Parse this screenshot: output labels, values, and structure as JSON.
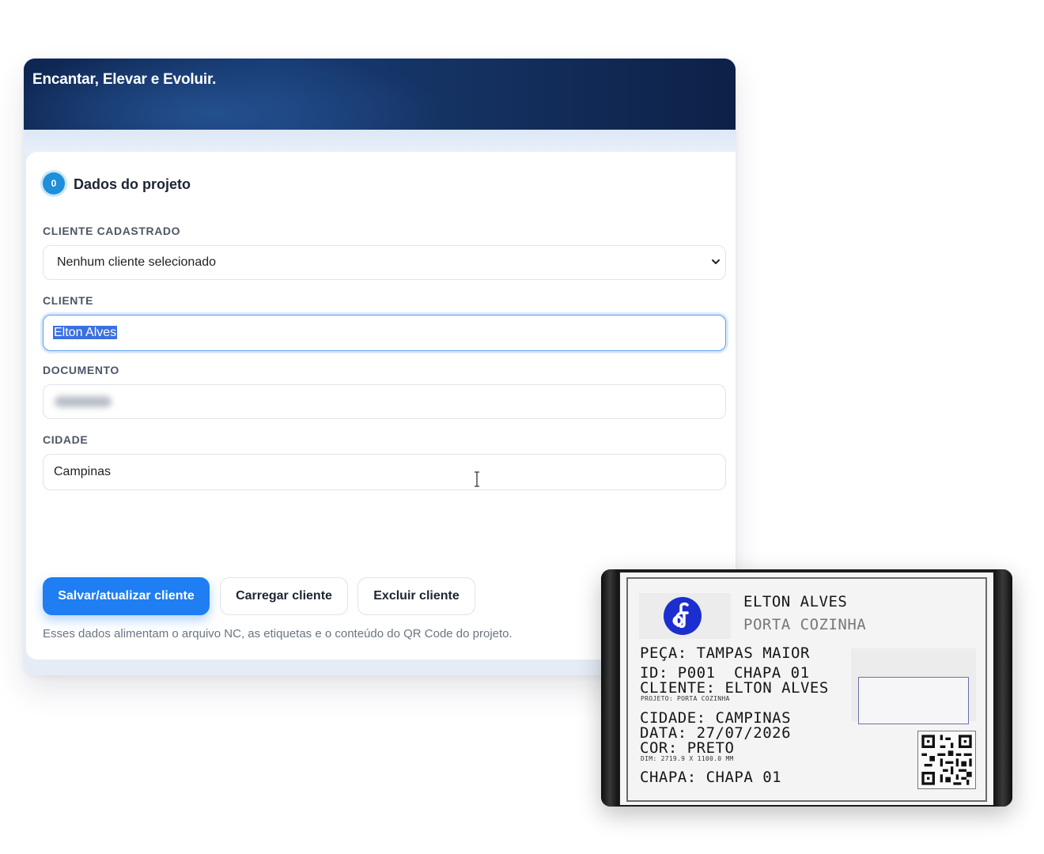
{
  "header": {
    "tagline": "Encantar, Elevar e Evoluir."
  },
  "section": {
    "number": "0",
    "title": "Dados do projeto"
  },
  "form": {
    "registered_client": {
      "label": "CLIENTE CADASTRADO",
      "value": "Nenhum cliente selecionado"
    },
    "client": {
      "label": "CLIENTE",
      "value": "Elton Alves"
    },
    "document": {
      "label": "DOCUMENTO",
      "value": ""
    },
    "city": {
      "label": "CIDADE",
      "value": "Campinas"
    }
  },
  "buttons": {
    "save": "Salvar/atualizar cliente",
    "load": "Carregar cliente",
    "delete": "Excluir cliente"
  },
  "hint": "Esses dados alimentam o arquivo NC, as etiquetas e o conteúdo do QR Code do projeto.",
  "label_print": {
    "client_name": "ELTON ALVES",
    "project_name": "PORTA COZINHA",
    "piece": "PEÇA: TAMPAS MAIOR",
    "id_line": "ID: P001",
    "sheet_line": "CHAPA 01",
    "client_line": "CLIENTE: ELTON ALVES",
    "project_line": "PROJETO: PORTA COZINHA",
    "city_line": "CIDADE: CAMPINAS",
    "date_line": "DATA: 27/07/2026",
    "color_line": "COR: PRETO",
    "dim_line": "DIM: 2719.9 X 1100.0 MM",
    "chapa_line": "CHAPA: CHAPA 01"
  },
  "colors": {
    "primary": "#1f7ef2",
    "header": "#14305f",
    "badge": "#1e8fd8",
    "logo": "#1b2fd0"
  },
  "icons": [
    "chevron-down-icon",
    "text-cursor-icon",
    "qr-code-icon",
    "logo-icon"
  ]
}
